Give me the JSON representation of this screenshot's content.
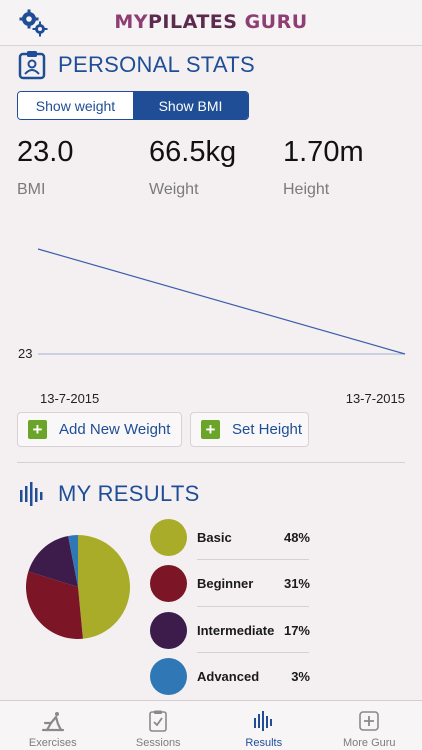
{
  "header": {
    "brand_my": "MY",
    "brand_pilates": "PILATES",
    "brand_guru": "GURU"
  },
  "personal_stats": {
    "title": "PERSONAL STATS",
    "toggle": {
      "show_weight": "Show weight",
      "show_bmi": "Show BMI",
      "selected": "Show BMI"
    },
    "stats": [
      {
        "value": "23.0",
        "label": "BMI"
      },
      {
        "value": "66.5kg",
        "label": "Weight"
      },
      {
        "value": "1.70m",
        "label": "Height"
      }
    ],
    "add_weight_label": "Add New Weight",
    "set_height_label": "Set Height"
  },
  "chart_data": {
    "type": "line",
    "x": [
      "13-7-2015",
      "13-7-2015"
    ],
    "series": [
      {
        "values": [
          23.3,
          23.0
        ]
      }
    ],
    "y_reference_label": "23",
    "x_start_label": "13-7-2015",
    "x_end_label": "13-7-2015",
    "line_color": "#3a5fa8"
  },
  "results": {
    "title": "MY RESULTS",
    "items": [
      {
        "name": "Basic",
        "pct": "48%",
        "value": 48,
        "color": "#a8ac28"
      },
      {
        "name": "Beginner",
        "pct": "31%",
        "value": 31,
        "color": "#7c1626"
      },
      {
        "name": "Intermediate",
        "pct": "17%",
        "value": 17,
        "color": "#3d1b4b"
      },
      {
        "name": "Advanced",
        "pct": "3%",
        "value": 3,
        "color": "#2f78b5"
      }
    ]
  },
  "tabs": [
    {
      "label": "Exercises",
      "icon": "exercise-icon",
      "active": false
    },
    {
      "label": "Sessions",
      "icon": "clipboard-icon",
      "active": false
    },
    {
      "label": "Results",
      "icon": "results-bars-icon",
      "active": true
    },
    {
      "label": "More Guru",
      "icon": "plus-square-icon",
      "active": false
    }
  ],
  "colors": {
    "accent": "#1f4e96",
    "brand": "#8e3e73",
    "green": "#6aa52a"
  }
}
